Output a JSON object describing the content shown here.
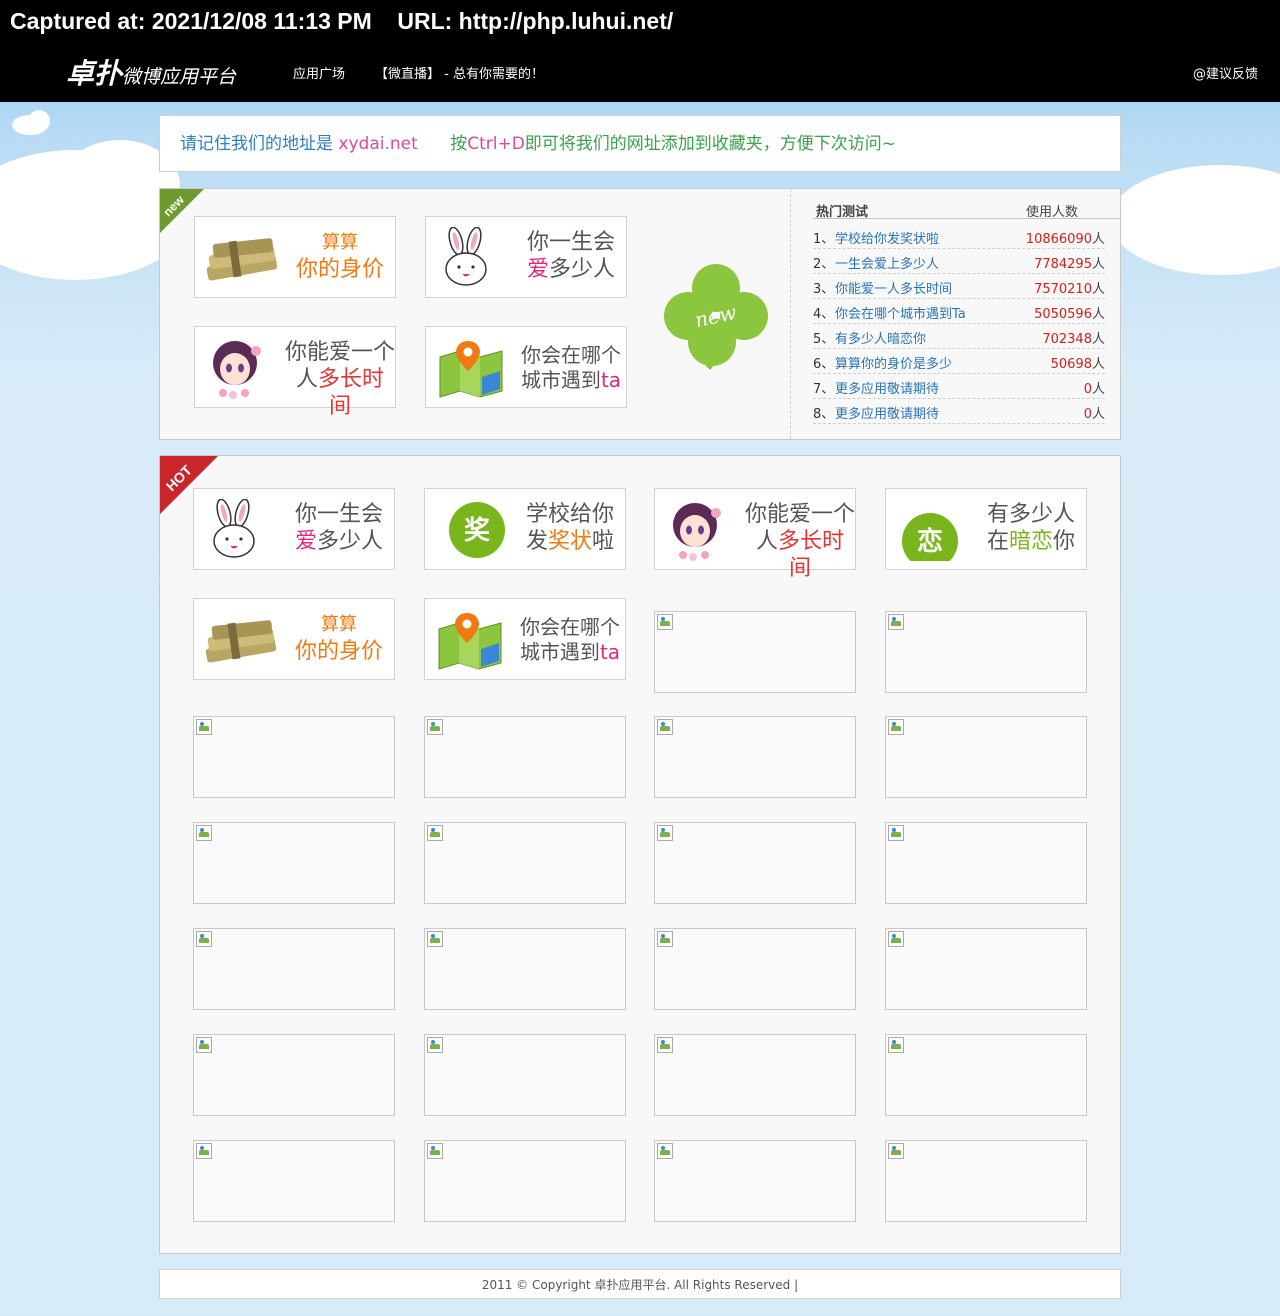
{
  "capture": {
    "text": "Captured at: 2021/12/08 11:13 PM    URL: http://php.luhui.net/"
  },
  "nav": {
    "logo_main": "卓扑",
    "logo_sub": "微博应用平台",
    "items": [
      "应用广场",
      "【微直播】 - 总有你需要的！"
    ],
    "feedback": "@建议反馈"
  },
  "notice": {
    "part1": "请记住我们的地址是 ",
    "site": "xydai.net",
    "part2": "      按",
    "shortcut": "Ctrl+D",
    "part3": "即可将我们的网址添加到收藏夹，方便下次访问~"
  },
  "new_panel": {
    "ribbon": "new",
    "clover_text": "new",
    "cards": [
      {
        "line1": "算算",
        "line2": "你的身价"
      },
      {
        "line1": "你一生会",
        "line2a": "爱",
        "line2b": "多少人"
      },
      {
        "line1": "你能爱一个",
        "line2a": "人",
        "line2b": "多长时间"
      },
      {
        "line1": "你会在哪个",
        "line2a": "城市遇到",
        "line2b": "ta"
      }
    ]
  },
  "rank": {
    "header_name": "热门测试",
    "header_count": "使用人数",
    "unit": "人",
    "rows": [
      {
        "no": "1、",
        "name": "学校给你发奖状啦",
        "count": "10866090"
      },
      {
        "no": "2、",
        "name": "一生会爱上多少人",
        "count": "7784295"
      },
      {
        "no": "3、",
        "name": "你能爱一人多长时间",
        "count": "7570210"
      },
      {
        "no": "4、",
        "name": "你会在哪个城市遇到Ta",
        "count": "5050596"
      },
      {
        "no": "5、",
        "name": "有多少人暗恋你",
        "count": "702348"
      },
      {
        "no": "6、",
        "name": "算算你的身价是多少",
        "count": "50698"
      },
      {
        "no": "7、",
        "name": "更多应用敬请期待",
        "count": "0"
      },
      {
        "no": "8、",
        "name": "更多应用敬请期待",
        "count": "0"
      }
    ]
  },
  "hot_panel": {
    "ribbon": "HOT",
    "cards": [
      {
        "line1": "你一生会",
        "line2a": "爱",
        "line2b": "多少人"
      },
      {
        "line1": "学校给你",
        "line2a": "发",
        "line2b": "奖状",
        "line2c": "啦",
        "badge": "奖"
      },
      {
        "line1": "你能爱一个",
        "line2a": "人",
        "line2b": "多长时间"
      },
      {
        "line1": "有多少人",
        "line2a": "在",
        "line2b": "暗恋",
        "line2c": "你",
        "badge": "恋"
      },
      {
        "line1": "算算",
        "line2": "你的身价"
      },
      {
        "line1": "你会在哪个",
        "line2a": "城市遇到",
        "line2b": "ta"
      }
    ]
  },
  "footer": {
    "text": "2011 © Copyright 卓扑应用平台. All Rights Reserved |"
  },
  "colors": {
    "accent_blue": "#2c7fc3",
    "accent_green": "#7ab51d",
    "hot_red": "#c8262a",
    "new_green": "#6f9a2f"
  }
}
